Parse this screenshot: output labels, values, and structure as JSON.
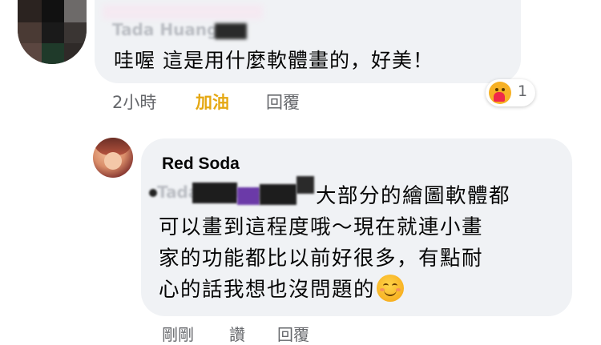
{
  "comments": [
    {
      "author_mention": "Tada Huang",
      "text": "哇喔 這是用什麼軟體畫的，好美！",
      "meta": {
        "time": "2小時",
        "like": "加油",
        "reply": "回覆"
      },
      "reaction": {
        "icon": "care-emoji-icon",
        "count": "1"
      }
    },
    {
      "author": "Red Soda",
      "mention": "Tada Huang",
      "lines": [
        "大部分的繪圖軟體都",
        "可以畫到這程度哦～現在就連小畫",
        "家的功能都比以前好很多，有點耐",
        "心的話我想也沒問題的"
      ],
      "emoji": "smiling-face-icon",
      "meta": {
        "time": "剛剛",
        "like": "讚",
        "reply": "回覆"
      }
    }
  ],
  "colors": {
    "bubble": "#f0f2f5",
    "meta_text": "#65676b",
    "liked_text": "#e5a812",
    "body_text": "#050505"
  }
}
